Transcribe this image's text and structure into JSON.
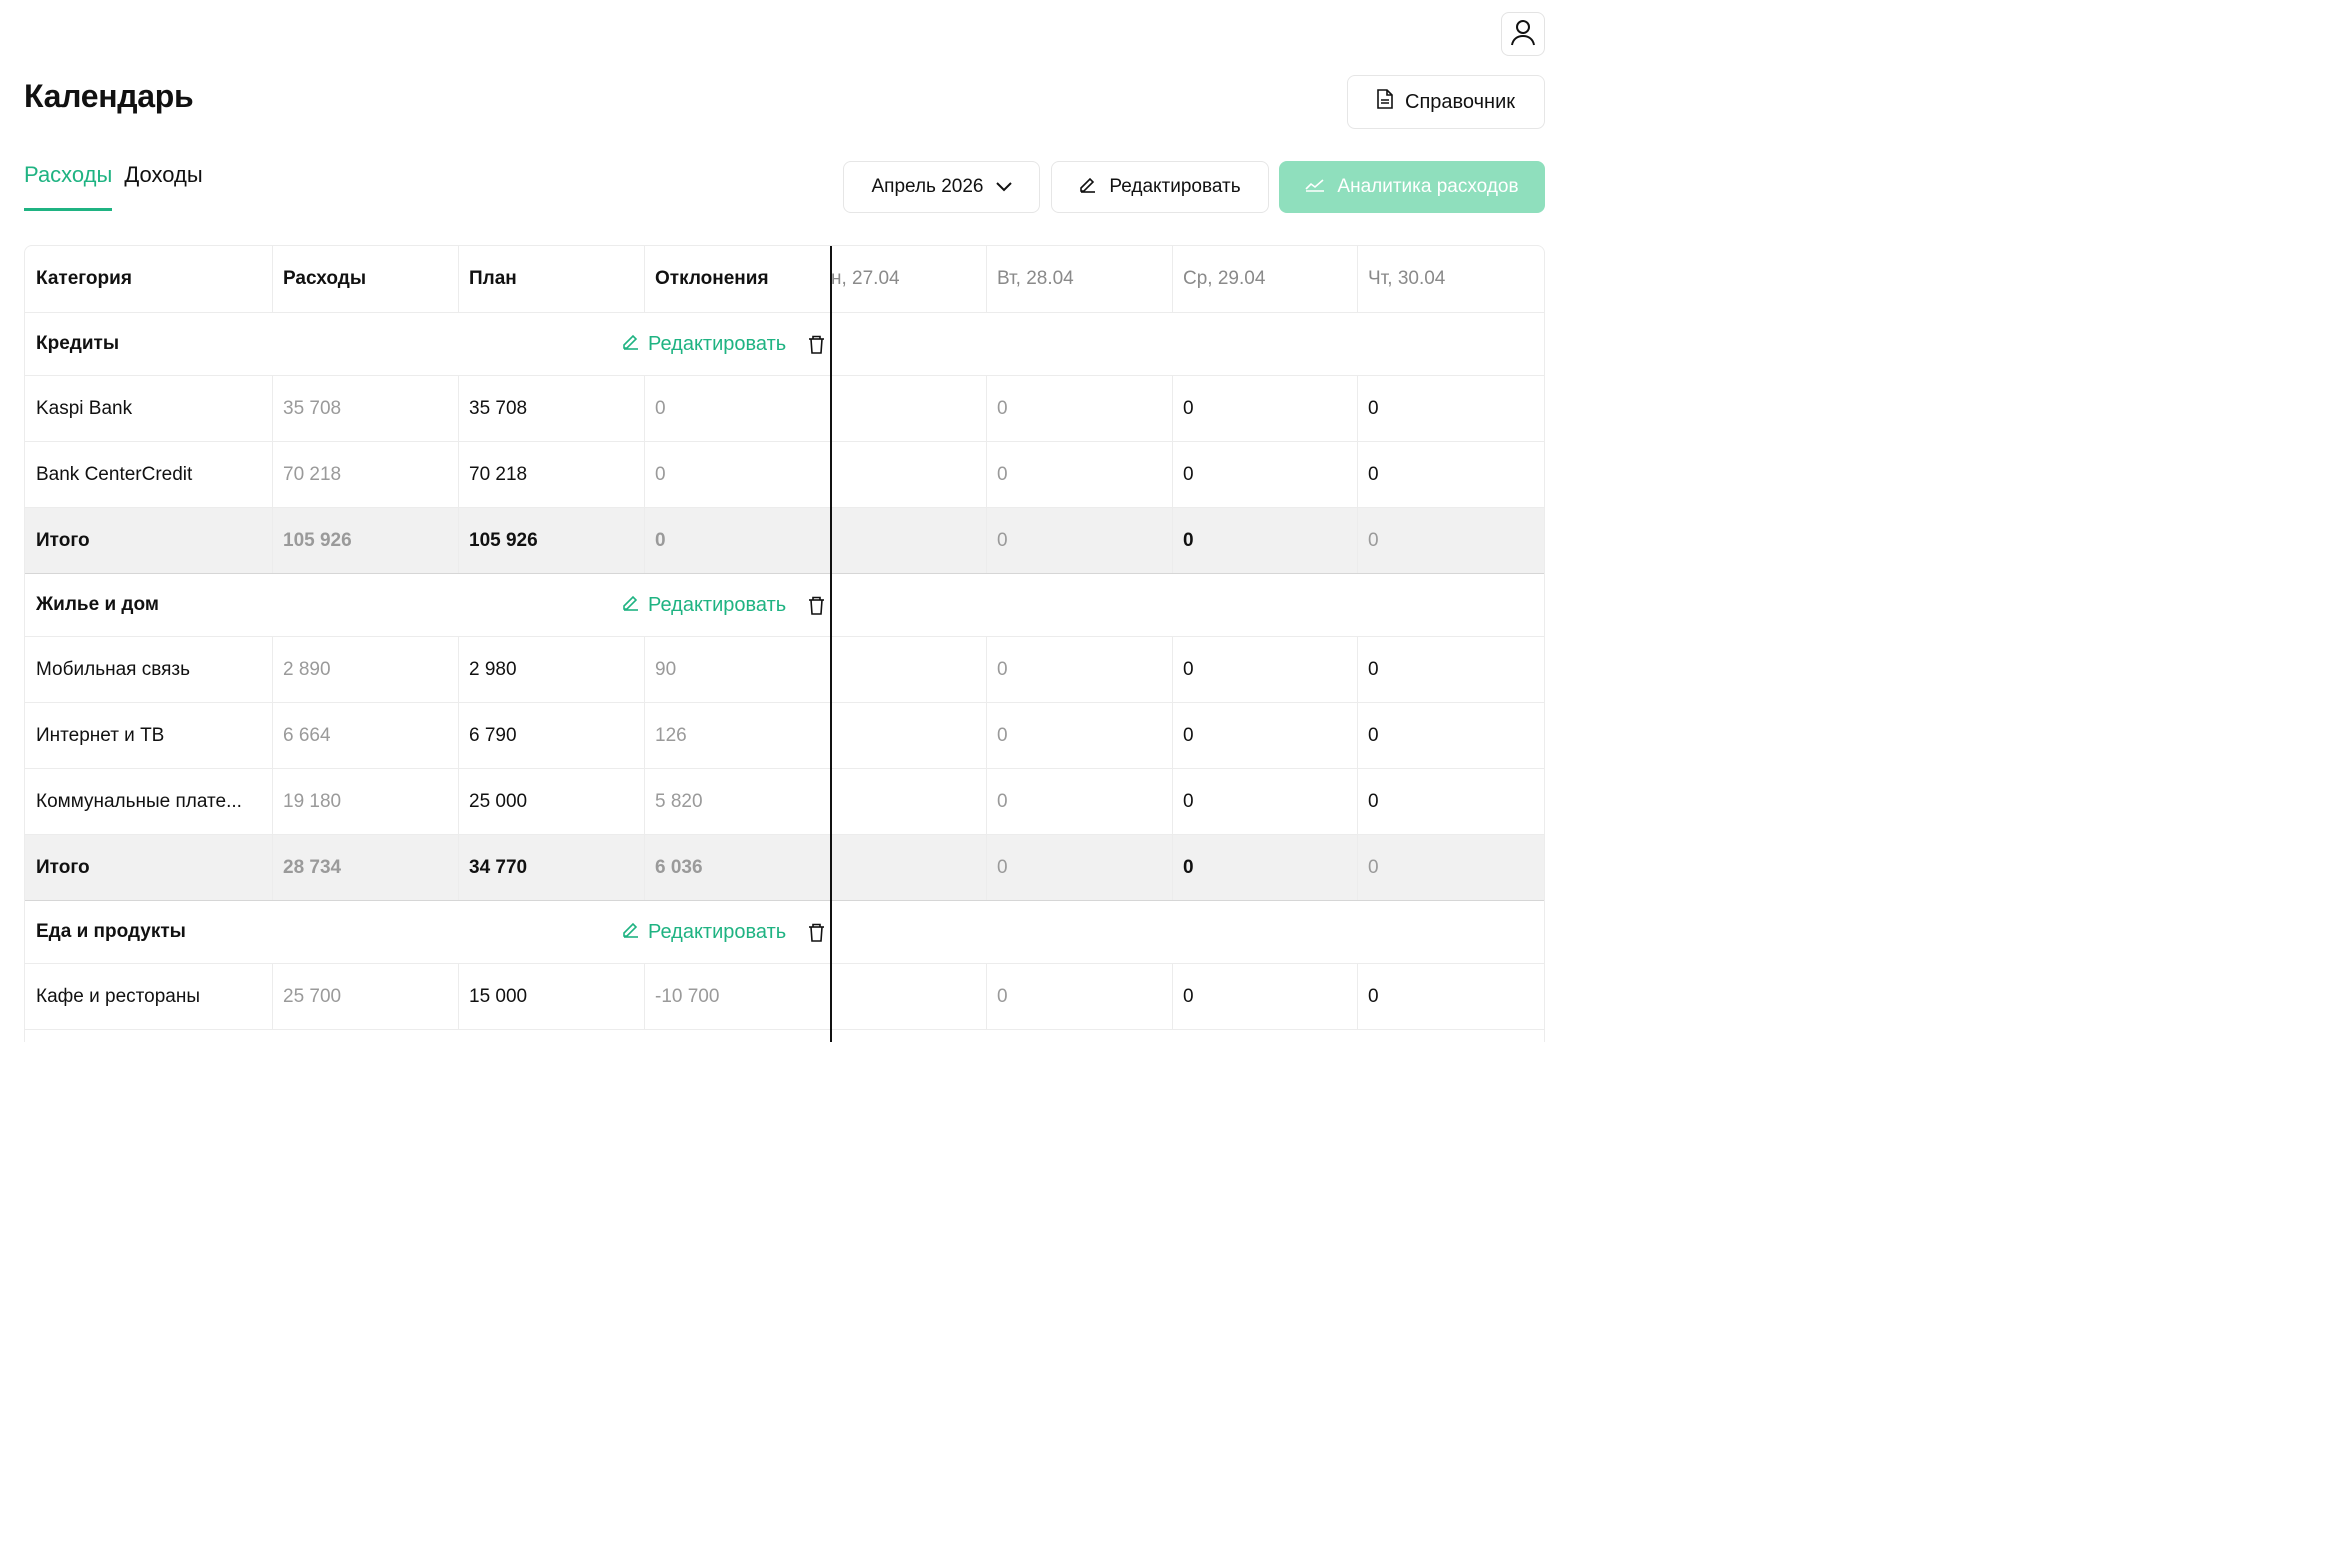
{
  "header": {
    "title": "Календарь",
    "reference_label": "Справочник"
  },
  "tabs": [
    {
      "label": "Расходы",
      "active": true
    },
    {
      "label": "Доходы",
      "active": false
    }
  ],
  "toolbar": {
    "month": "Апрель 2026",
    "edit_label": "Редактировать",
    "analytics_label": "Аналитика расходов"
  },
  "table": {
    "columns": [
      "Категория",
      "Расходы",
      "План",
      "Отклонения",
      "н, 27.04",
      "Вт, 28.04",
      "Ср, 29.04",
      "Чт, 30.04"
    ],
    "group_edit_label": "Редактировать",
    "groups": [
      {
        "name": "Кредиты",
        "rows": [
          {
            "category": "Kaspi Bank",
            "spent": "35 708",
            "plan": "35 708",
            "deviation": "0",
            "d27": "",
            "d28": "0",
            "d29": "0",
            "d30": "0"
          },
          {
            "category": "Bank CenterCredit",
            "spent": "70 218",
            "plan": "70 218",
            "deviation": "0",
            "d27": "",
            "d28": "0",
            "d29": "0",
            "d30": "0"
          }
        ],
        "total": {
          "label": "Итого",
          "spent": "105 926",
          "plan": "105 926",
          "deviation": "0",
          "d27": "",
          "d28": "0",
          "d29": "0",
          "d30": "0"
        }
      },
      {
        "name": "Жилье и дом",
        "rows": [
          {
            "category": "Мобильная связь",
            "spent": "2 890",
            "plan": "2 980",
            "deviation": "90",
            "d27": "",
            "d28": "0",
            "d29": "0",
            "d30": "0"
          },
          {
            "category": "Интернет и ТВ",
            "spent": "6 664",
            "plan": "6 790",
            "deviation": "126",
            "d27": "",
            "d28": "0",
            "d29": "0",
            "d30": "0"
          },
          {
            "category": "Коммунальные плате...",
            "spent": "19 180",
            "plan": "25 000",
            "deviation": "5 820",
            "d27": "",
            "d28": "0",
            "d29": "0",
            "d30": "0"
          }
        ],
        "total": {
          "label": "Итого",
          "spent": "28 734",
          "plan": "34 770",
          "deviation": "6 036",
          "d27": "",
          "d28": "0",
          "d29": "0",
          "d30": "0"
        }
      },
      {
        "name": "Еда и продукты",
        "rows": [
          {
            "category": "Кафе и рестораны",
            "spent": "25 700",
            "plan": "15 000",
            "deviation": "-10 700",
            "d27": "",
            "d28": "0",
            "d29": "0",
            "d30": "0"
          }
        ]
      }
    ]
  },
  "colors": {
    "accent": "#1fb382",
    "accent_disabled": "#8fdfbd",
    "muted_text": "#9a9a9a",
    "total_row_bg": "#f1f1f1"
  },
  "icons": {
    "user": "user-icon",
    "reference": "document-icon",
    "month": "chevron-down-icon",
    "edit": "pencil-icon",
    "analytics": "chart-line-icon",
    "delete": "trash-icon"
  }
}
